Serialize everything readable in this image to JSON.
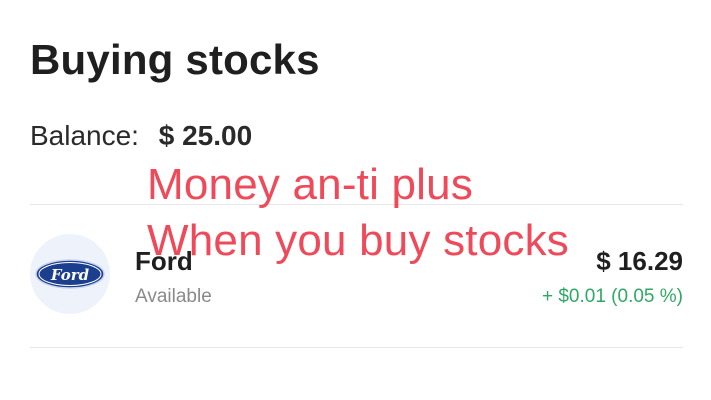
{
  "header": {
    "title": "Buying stocks"
  },
  "balance": {
    "label": "Balance:",
    "value": "$ 25.00"
  },
  "stock": {
    "logo_text": "Ford",
    "name": "Ford",
    "status": "Available",
    "price": "$ 16.29",
    "change": "+ $0.01 (0.05 %)",
    "change_color": "#2fa866"
  },
  "overlay": {
    "line1": "Money an-ti plus",
    "line2": "When you buy stocks",
    "color": "#ee4a5a"
  }
}
